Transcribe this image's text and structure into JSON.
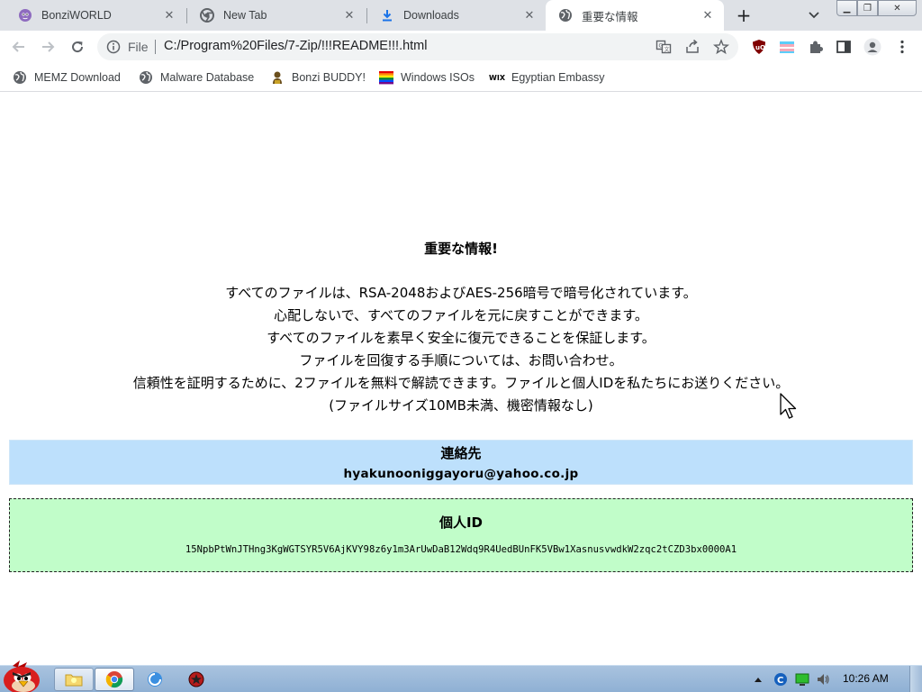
{
  "tabs": [
    {
      "title": "BonziWORLD",
      "icon": "bonzi-icon",
      "active": false
    },
    {
      "title": "New Tab",
      "icon": "chrome-icon",
      "active": false
    },
    {
      "title": "Downloads",
      "icon": "download-icon",
      "active": false
    },
    {
      "title": "重要な情報",
      "icon": "globe-icon",
      "active": true
    }
  ],
  "tab_close_glyph": "✕",
  "new_tab_glyph": "+",
  "window_controls": {
    "minimize": "▁",
    "maximize": "❐",
    "close": "✕"
  },
  "omnibox": {
    "scheme": "File",
    "url": "C:/Program%20Files/7-Zip/!!!README!!!.html"
  },
  "bookmarks": [
    {
      "label": "MEMZ Download",
      "icon": "globe-icon"
    },
    {
      "label": "Malware Database",
      "icon": "globe-icon"
    },
    {
      "label": "Bonzi BUDDY!",
      "icon": "bonzi-buddy-icon"
    },
    {
      "label": "Windows ISOs",
      "icon": "rainbow-flag-icon"
    },
    {
      "label": "Egyptian Embassy",
      "icon": "wix-icon"
    }
  ],
  "bookmark_wix_text": "WIX",
  "page": {
    "heading": "重要な情報!",
    "lines": [
      "すべてのファイルは、RSA-2048およびAES-256暗号で暗号化されています。",
      "心配しないで、すべてのファイルを元に戻すことができます。",
      "すべてのファイルを素早く安全に復元できることを保証します。",
      "ファイルを回復する手順については、お問い合わせ。",
      "信頼性を証明するために、2ファイルを無料で解読できます。ファイルと個人IDを私たちにお送りください。",
      "(ファイルサイズ10MB未満、機密情報なし)"
    ],
    "contact": {
      "title": "連絡先",
      "email": "hyakunooniggayoru@yahoo.co.jp"
    },
    "personal_id": {
      "title": "個人ID",
      "value": "15NpbPtWnJTHng3KgWGTSYR5V6AjKVY98z6y1m3ArUwDaB12Wdq9R4UedBUnFK5VBw1XasnusvwdkW2zqc2tCZD3bx0000A1"
    }
  },
  "taskbar": {
    "clock": "10:26 AM"
  },
  "colors": {
    "tabstrip": "#dee1e6",
    "contact_bg": "#bde0fc",
    "id_bg": "#c1fdc9",
    "taskbar": "#a9c3df"
  }
}
